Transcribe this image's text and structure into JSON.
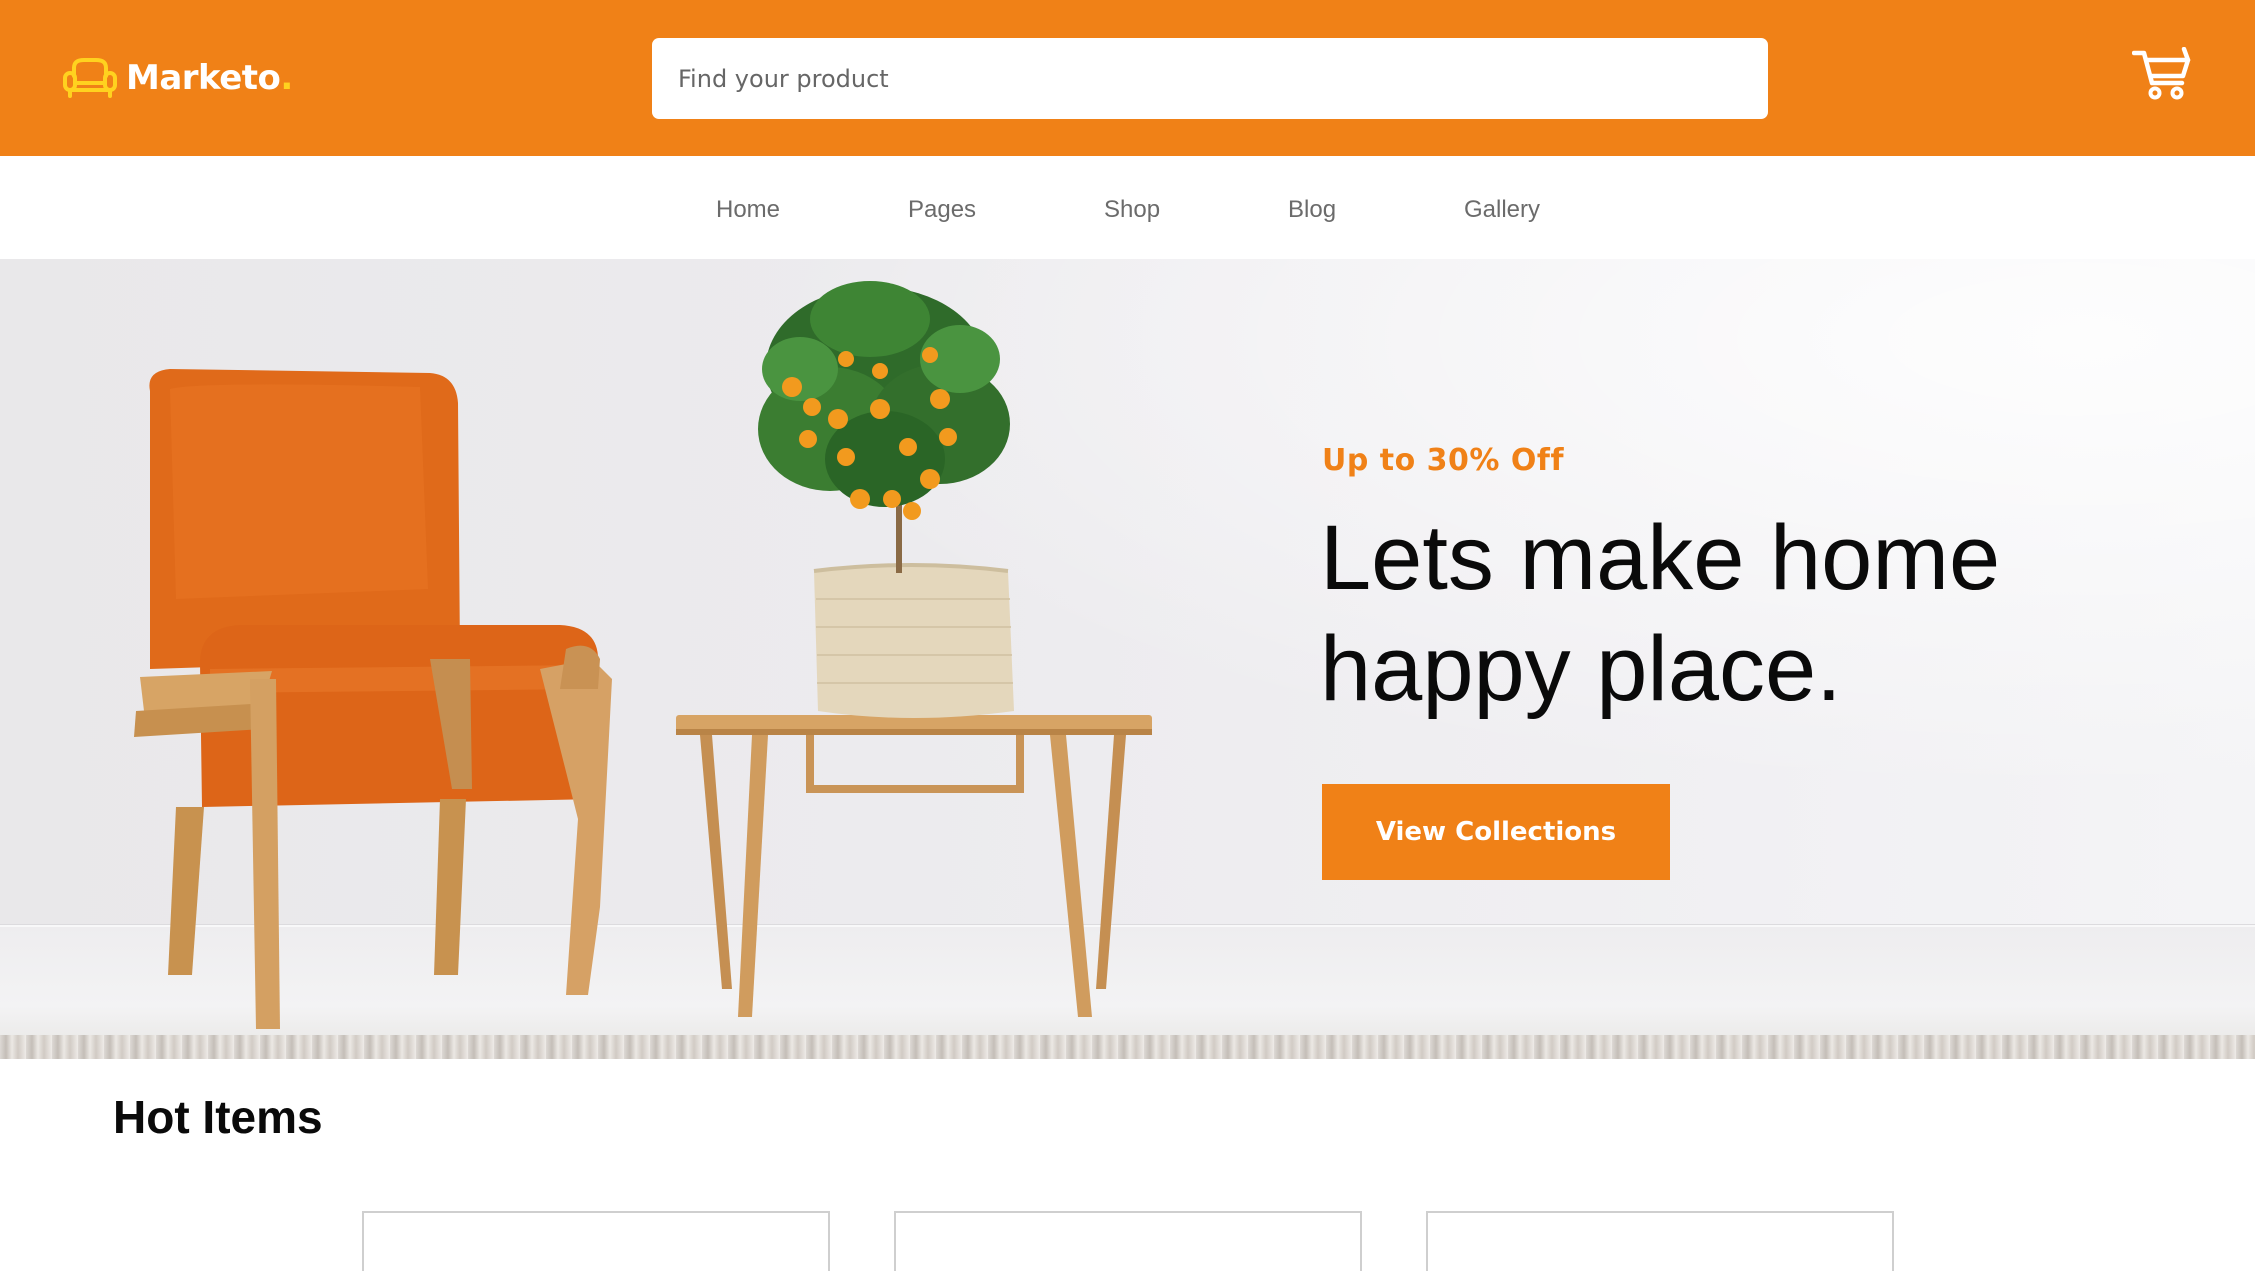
{
  "header": {
    "brand": "Marketo",
    "brand_dot": ".",
    "search_placeholder": "Find your product",
    "logo_icon": "sofa-icon",
    "cart_icon": "cart-icon"
  },
  "nav": {
    "items": [
      {
        "label": "Home"
      },
      {
        "label": "Pages"
      },
      {
        "label": "Shop"
      },
      {
        "label": "Blog"
      },
      {
        "label": "Gallery"
      }
    ]
  },
  "hero": {
    "promo": "Up to 30% Off",
    "headline_line1": "Lets make home",
    "headline_line2": "happy place.",
    "cta_label": "View Collections"
  },
  "hot_items": {
    "title": "Hot Items",
    "cards": 3
  },
  "colors": {
    "accent": "#F08117",
    "logo_yellow": "#FFD21F"
  }
}
